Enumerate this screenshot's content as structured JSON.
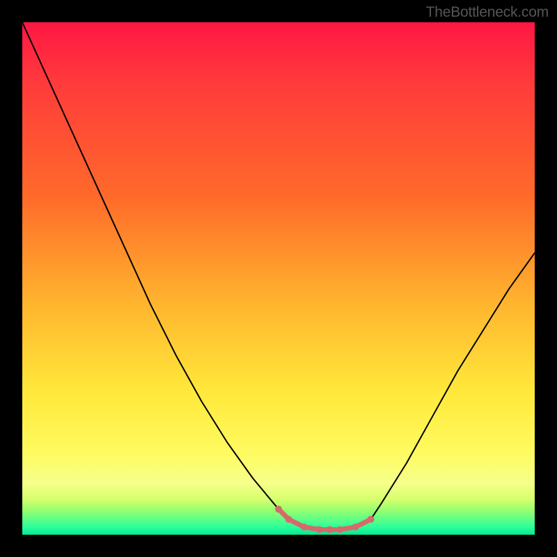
{
  "attribution": "TheBottleneck.com",
  "colors": {
    "background": "#000000",
    "gradient_top": "#ff1744",
    "gradient_mid": "#ffe83a",
    "gradient_bottom": "#00e894",
    "curve_stroke": "#000000",
    "marker_stroke": "#d66a6a",
    "marker_fill": "#d66a6a"
  },
  "chart_data": {
    "type": "line",
    "title": "",
    "xlabel": "",
    "ylabel": "",
    "xlim": [
      0,
      100
    ],
    "ylim": [
      0,
      100
    ],
    "series": [
      {
        "name": "bottleneck-curve",
        "x": [
          0,
          5,
          10,
          15,
          20,
          25,
          30,
          35,
          40,
          45,
          50,
          52,
          55,
          58,
          60,
          62,
          65,
          68,
          70,
          75,
          80,
          85,
          90,
          95,
          100
        ],
        "values": [
          100,
          89,
          78,
          67,
          56,
          45,
          35,
          26,
          18,
          11,
          5,
          3,
          1.5,
          1,
          1,
          1,
          1.5,
          3,
          6,
          14,
          23,
          32,
          40,
          48,
          55
        ]
      }
    ],
    "markers": {
      "name": "optimal-zone",
      "x": [
        50,
        52,
        55,
        58,
        60,
        62,
        65,
        68
      ],
      "values": [
        5,
        3,
        1.5,
        1,
        1,
        1,
        1.5,
        3
      ]
    },
    "gradient_stops": [
      {
        "pos": 0.0,
        "color": "#ff1744"
      },
      {
        "pos": 0.34,
        "color": "#ff6a2a"
      },
      {
        "pos": 0.72,
        "color": "#ffe83a"
      },
      {
        "pos": 0.95,
        "color": "#9dff6e"
      },
      {
        "pos": 1.0,
        "color": "#00e894"
      }
    ]
  }
}
